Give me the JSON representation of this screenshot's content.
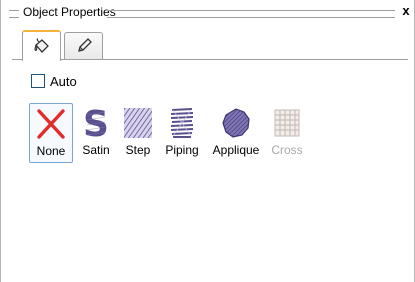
{
  "panel": {
    "title": "Object Properties",
    "close_glyph": "x"
  },
  "tabs": [
    {
      "icon": "paint-bucket-icon",
      "active": true
    },
    {
      "icon": "pencil-icon",
      "active": false
    }
  ],
  "auto": {
    "label": "Auto",
    "checked": false
  },
  "stitch_types": [
    {
      "label": "None",
      "icon": "red-x-icon",
      "selected": true,
      "enabled": true
    },
    {
      "label": "Satin",
      "icon": "satin-s-icon",
      "selected": false,
      "enabled": true
    },
    {
      "label": "Step",
      "icon": "step-fill-icon",
      "selected": false,
      "enabled": true
    },
    {
      "label": "Piping",
      "icon": "piping-icon",
      "selected": false,
      "enabled": true
    },
    {
      "label": "Applique",
      "icon": "applique-icon",
      "selected": false,
      "enabled": true
    },
    {
      "label": "Cross",
      "icon": "cross-stitch-icon",
      "selected": false,
      "enabled": false
    }
  ],
  "colors": {
    "selected_border": "#7aa6d3",
    "active_tab_accent": "#f5b23a",
    "stitch_purple": "#5a4f8f",
    "none_red": "#e22b2b",
    "disabled_text": "#a8a8a8"
  }
}
